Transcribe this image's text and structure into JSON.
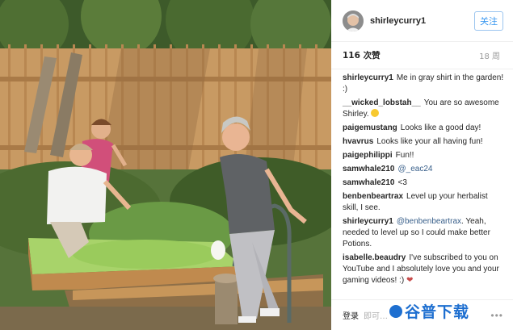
{
  "post": {
    "username": "shirleycurry1",
    "follow_label": "关注",
    "likes": "116 次赞",
    "time": "18 周"
  },
  "comments": [
    {
      "user": "shirleycurry1",
      "text": "Me in gray shirt in the garden! :)"
    },
    {
      "user": "__wicked_lobstah__",
      "text": "You are so awesome Shirley.",
      "emoji": "grin-emoji"
    },
    {
      "user": "paigemustang",
      "text": "Looks like a good day!"
    },
    {
      "user": "hvavrus",
      "text": "Looks like your all having fun!"
    },
    {
      "user": "paigephilippi",
      "text": "Fun!!"
    },
    {
      "user": "samwhale210",
      "mention": "@_eac24",
      "text": ""
    },
    {
      "user": "samwhale210",
      "text": "<3"
    },
    {
      "user": "benbenbeartrax",
      "text": "Level up your herbalist skill, I see."
    },
    {
      "user": "shirleycurry1",
      "mention": "@benbenbeartrax",
      "text": ". Yeah, needed to level up so I could make better Potions."
    },
    {
      "user": "isabelle.beaudry",
      "text": "I've subscribed to you on YouTube and I absolutely love you and your gaming videos! :)",
      "emoji": "heart-emoji"
    }
  ],
  "footer": {
    "login_label": "登录",
    "comment_prompt": "即可…",
    "more_label": "•••"
  },
  "watermark": {
    "text": "谷普下载"
  },
  "colors": {
    "accent": "#3897f0",
    "watermark": "#1e6fd0"
  }
}
